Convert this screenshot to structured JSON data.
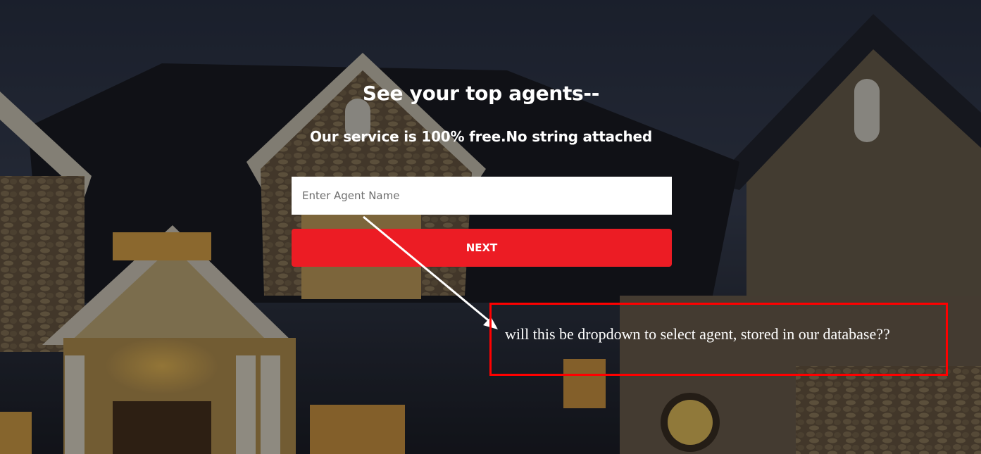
{
  "hero": {
    "title": "See your top agents--",
    "subtitle": "Our service is 100% free.No string attached"
  },
  "form": {
    "agent_input_placeholder": "Enter Agent Name",
    "agent_input_value": "",
    "next_label": "NEXT"
  },
  "annotation": {
    "note": "will this be dropdown to select agent, stored in our database??",
    "color": "#ff0000"
  },
  "colors": {
    "button": "#ec1c24",
    "text": "#ffffff"
  },
  "background": "house-photo-night"
}
